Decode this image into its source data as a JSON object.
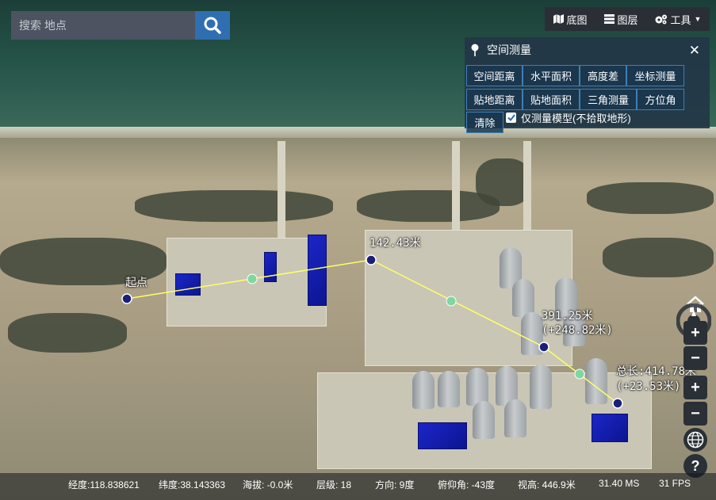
{
  "search": {
    "placeholder": "搜索 地点"
  },
  "toolbar": {
    "basemap_label": "底图",
    "layers_label": "图层",
    "tools_label": "工具"
  },
  "measure_panel": {
    "title": "空间测量",
    "buttons_row1": [
      "空间距离",
      "水平面积",
      "高度差",
      "坐标测量"
    ],
    "buttons_row2": [
      "贴地距离",
      "贴地面积",
      "三角测量",
      "方位角"
    ],
    "clear_label": "清除",
    "checkbox_label": "仅测量模型(不拾取地形)",
    "checkbox_checked": true
  },
  "measure_labels": {
    "start": "起点",
    "seg1": "142.43米",
    "seg2_line1": "391.25米",
    "seg2_line2": "(+248.82米)",
    "total_line1": "总长:414.78米",
    "total_line2": "(+23.53米)"
  },
  "status": {
    "longitude": "经度:118.838621",
    "latitude": "纬度:38.143363",
    "altitude": "海拔: -0.0米",
    "level": "层级:  18",
    "heading": "方向: 9度",
    "pitch": "俯仰角: -43度",
    "view_height": "视高: 446.9米",
    "ms": "31.40 MS",
    "fps": "31 FPS"
  },
  "colors": {
    "measure_line": "#ffff66",
    "measure_point": "#1a1f7a",
    "midpoint": "#7fd7a0",
    "panel_bg": "#233646",
    "button_border": "#3f7fb5",
    "search_button": "#2f6fb1"
  },
  "icons": {
    "search": "search-icon",
    "basemap": "map-icon",
    "layers": "layers-icon",
    "tools": "cogs-icon",
    "panel": "pin-icon",
    "close": "close-icon",
    "home": "home-icon",
    "globe": "globe-icon",
    "help": "help-icon"
  }
}
